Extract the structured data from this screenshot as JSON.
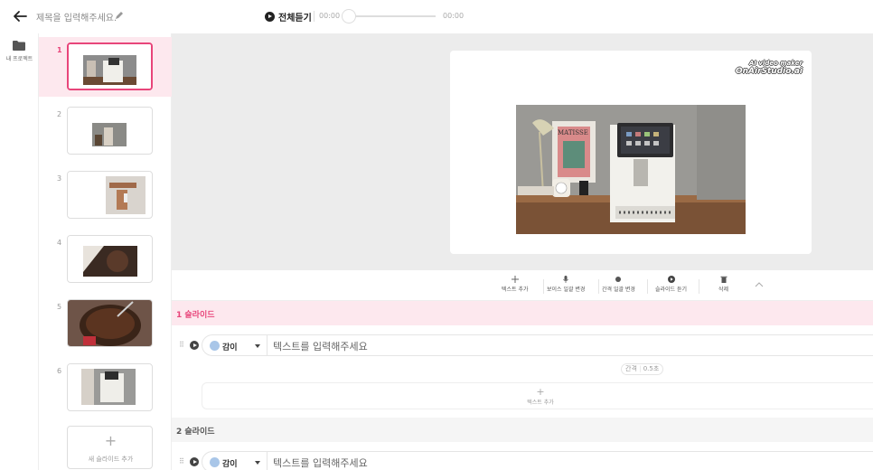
{
  "topbar": {
    "title": "제목을 입력해주세요.",
    "play_all_label": "전체듣기",
    "time_current": "00:00",
    "time_total": "00:00",
    "progress": 0
  },
  "leftnav": {
    "projects_label": "내 프로젝트"
  },
  "slides": [
    {
      "number": "1",
      "active": true
    },
    {
      "number": "2",
      "active": false
    },
    {
      "number": "3",
      "active": false
    },
    {
      "number": "4",
      "active": false
    },
    {
      "number": "5",
      "active": false
    },
    {
      "number": "6",
      "active": false
    }
  ],
  "add_slide_label": "새 슬라이드 추가",
  "watermark": {
    "line1": "AI video maker",
    "line2": "OnAirStudio.ai"
  },
  "toolbar": {
    "add_text": "텍스트 추가",
    "voice_change": "보이스 일괄 변경",
    "interval_change": "간격 일괄 변경",
    "slide_listen": "슬라이드 듣기",
    "delete": "삭제"
  },
  "editor": {
    "section1_title": "1 슬라이드",
    "section2_title": "2 슬라이드",
    "row1": {
      "voice": "감이",
      "placeholder": "텍스트를 입력해주세요"
    },
    "row2": {
      "voice": "감이",
      "placeholder": "텍스트를 입력해주세요"
    },
    "interval_label": "간격",
    "interval_value": "0.5초",
    "add_text_label": "텍스트 추가"
  },
  "colors": {
    "accent": "#e8457a",
    "accent_bg": "#fde8ee",
    "preview_bg": "#ececec"
  }
}
